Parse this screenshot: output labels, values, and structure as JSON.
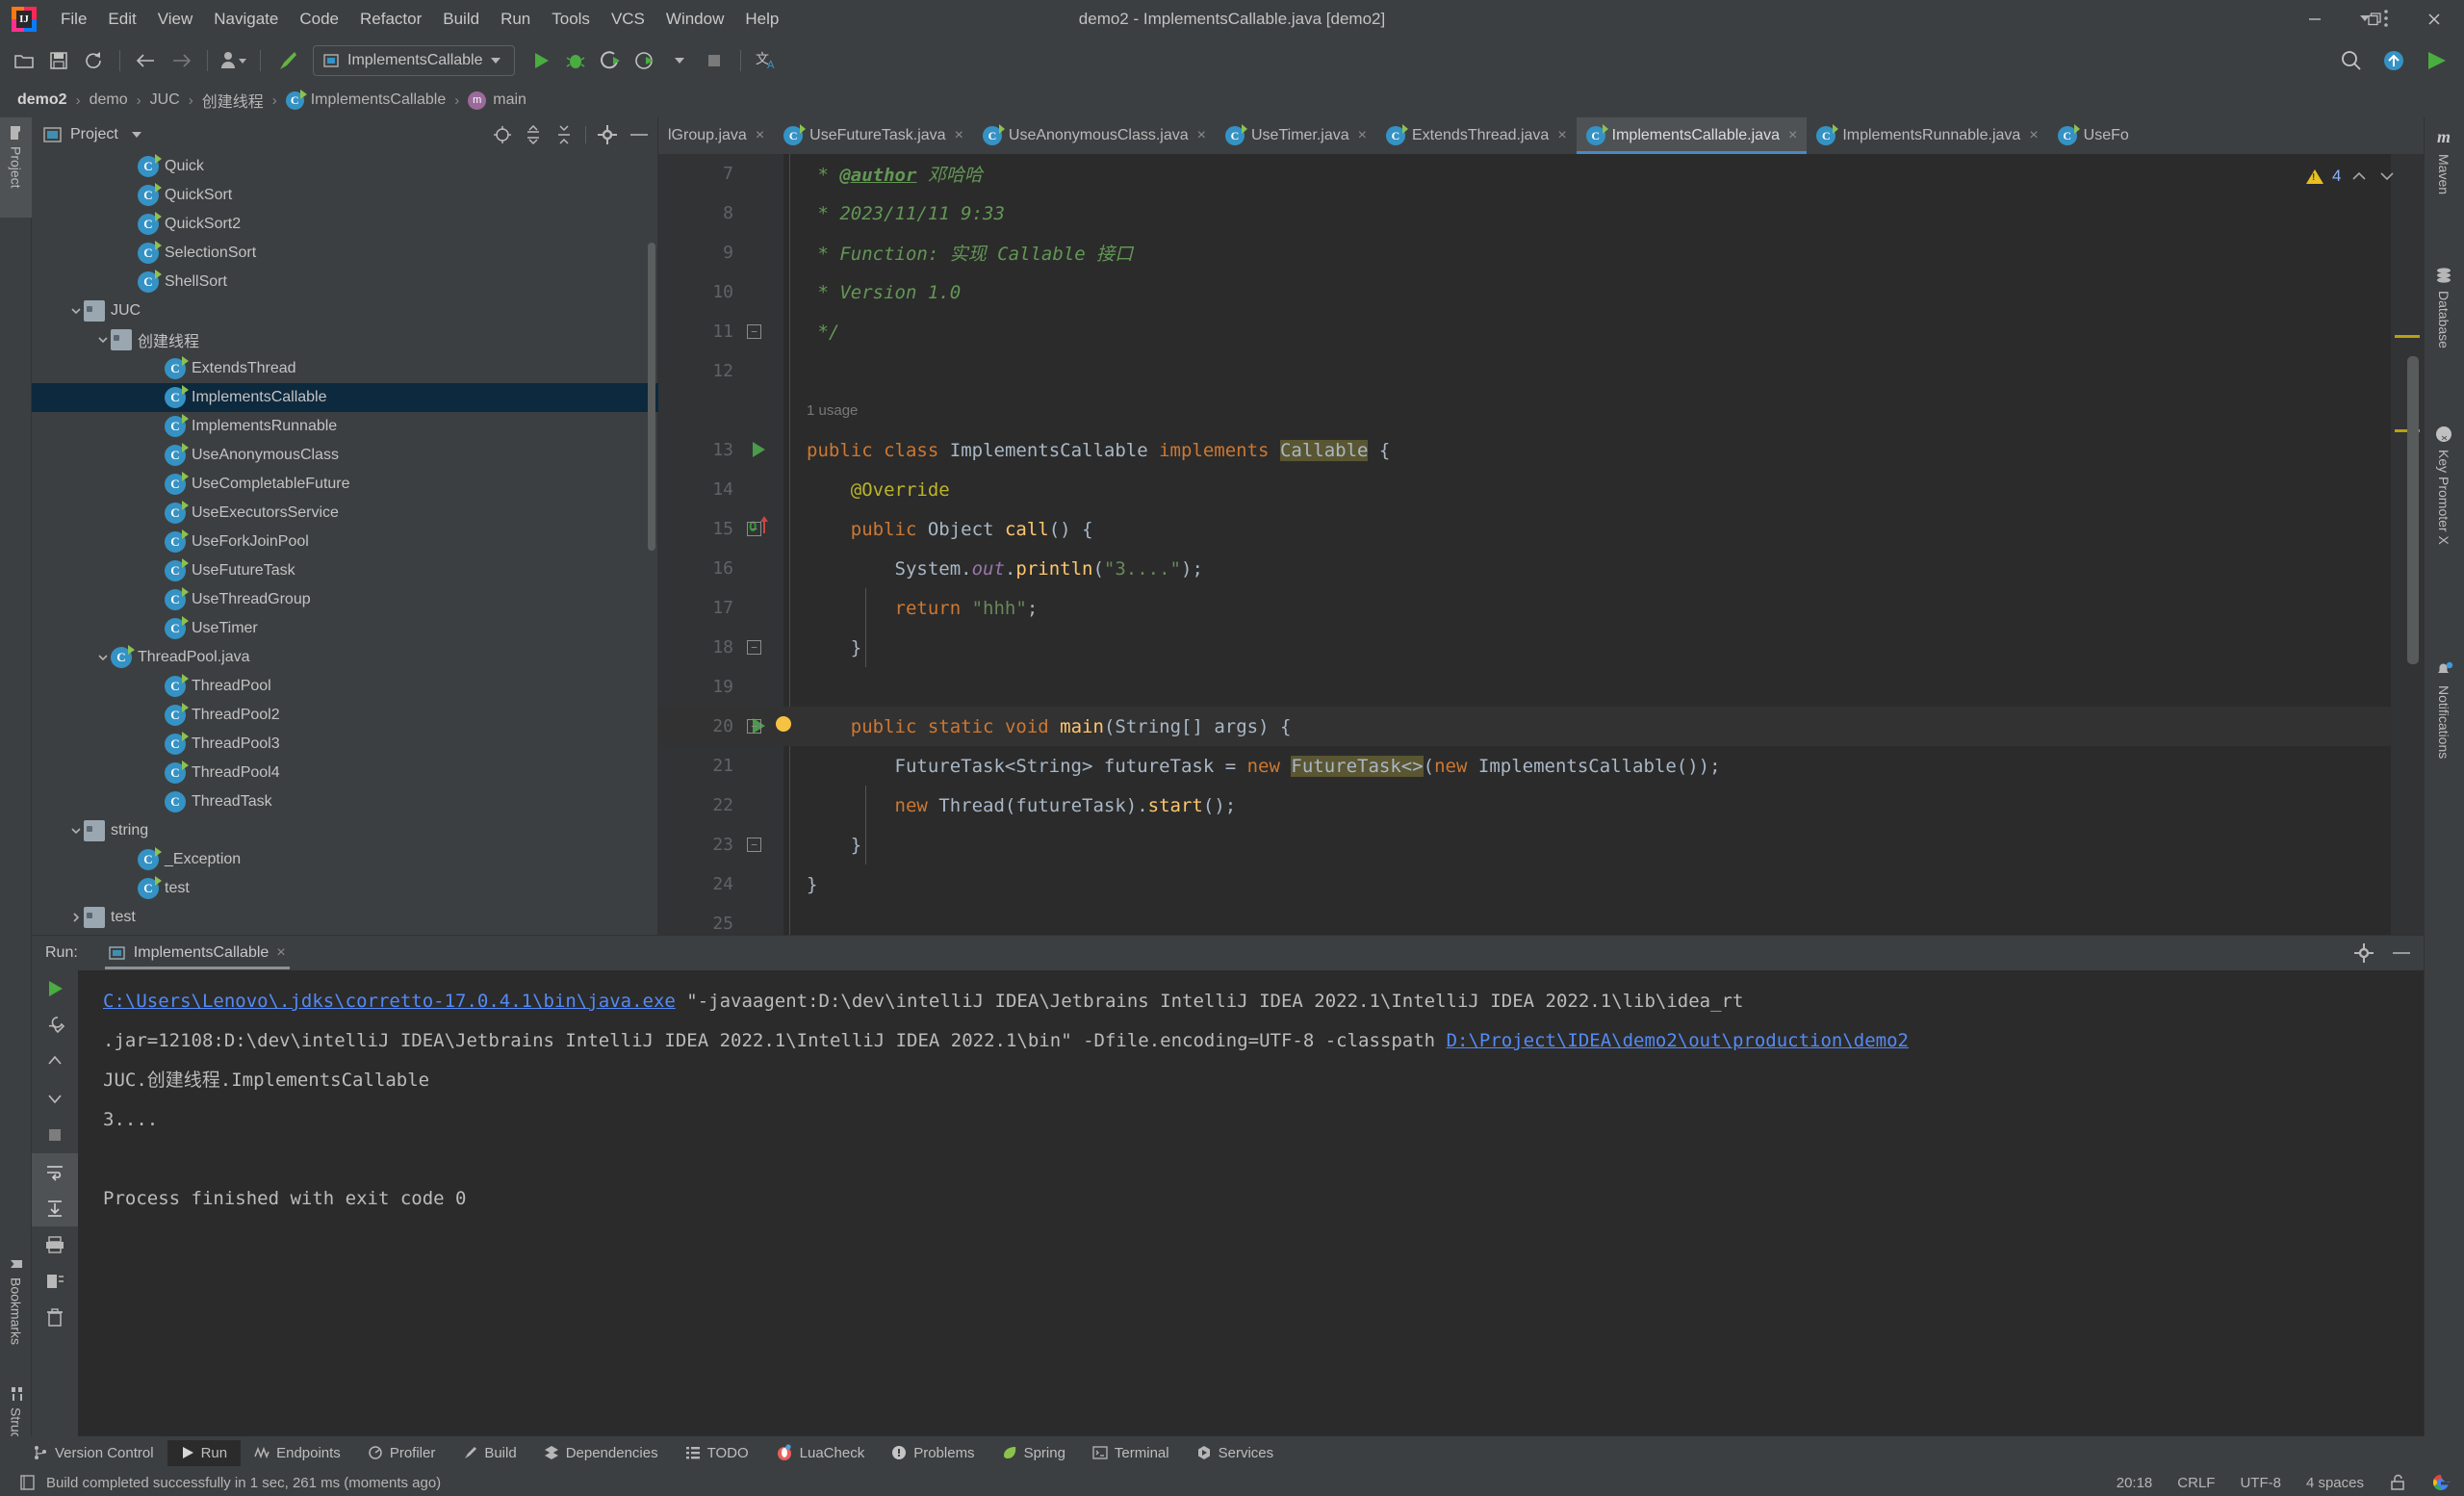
{
  "window": {
    "title": "demo2 - ImplementsCallable.java [demo2]",
    "minimize_label": "minimize-window",
    "restore_label": "restore-window",
    "close_label": "close-window"
  },
  "menubar": {
    "items": [
      "File",
      "Edit",
      "View",
      "Navigate",
      "Code",
      "Refactor",
      "Build",
      "Run",
      "Tools",
      "VCS",
      "Window",
      "Help"
    ]
  },
  "toolbar": {
    "open_icon": "folder-open-icon",
    "save_icon": "save-icon",
    "sync_icon": "refresh-icon",
    "back_icon": "arrow-left-icon",
    "forward_icon": "arrow-right-icon",
    "profile_icon": "user-profile-icon",
    "build_icon": "hammer-icon",
    "run_config": "ImplementsCallable",
    "run_icon": "run-icon",
    "debug_icon": "debug-icon",
    "coverage_icon": "run-with-coverage-icon",
    "profile_run_icon": "profile-icon",
    "stop_icon": "stop-icon",
    "translate_icon": "translate-icon",
    "search_icon": "search-everywhere-icon",
    "update_icon": "update-icon",
    "run_green_icon": "run-green-icon"
  },
  "breadcrumb": {
    "items": [
      "demo2",
      "demo",
      "JUC",
      "创建线程",
      "ImplementsCallable",
      "main"
    ],
    "separator": "›"
  },
  "left_strip": {
    "project": "Project",
    "bookmarks": "Bookmarks",
    "structure": "Structure"
  },
  "right_strip": {
    "maven": "Maven",
    "database": "Database",
    "key_promoter": "Key Promoter X",
    "notifications": "Notifications"
  },
  "project_panel": {
    "title": "Project",
    "tools": [
      "locate-icon",
      "expand-all-icon",
      "collapse-all-icon",
      "settings-gear-icon",
      "hide-icon"
    ],
    "tree": [
      {
        "label": "Quick",
        "depth": 4,
        "icon": "java-class-icon",
        "twisty": "",
        "selected": false
      },
      {
        "label": "QuickSort",
        "depth": 4,
        "icon": "java-class-icon",
        "twisty": "",
        "selected": false
      },
      {
        "label": "QuickSort2",
        "depth": 4,
        "icon": "java-class-icon",
        "twisty": "",
        "selected": false
      },
      {
        "label": "SelectionSort",
        "depth": 4,
        "icon": "java-class-icon",
        "twisty": "",
        "selected": false
      },
      {
        "label": "ShellSort",
        "depth": 4,
        "icon": "java-class-icon",
        "twisty": "",
        "selected": false
      },
      {
        "label": "JUC",
        "depth": 2,
        "icon": "folder-icon",
        "twisty": "expanded",
        "selected": false
      },
      {
        "label": "创建线程",
        "depth": 3,
        "icon": "folder-icon",
        "twisty": "expanded",
        "selected": false
      },
      {
        "label": "ExtendsThread",
        "depth": 5,
        "icon": "java-class-icon",
        "twisty": "",
        "selected": false
      },
      {
        "label": "ImplementsCallable",
        "depth": 5,
        "icon": "java-class-icon",
        "twisty": "",
        "selected": true
      },
      {
        "label": "ImplementsRunnable",
        "depth": 5,
        "icon": "java-class-icon",
        "twisty": "",
        "selected": false
      },
      {
        "label": "UseAnonymousClass",
        "depth": 5,
        "icon": "java-class-icon",
        "twisty": "",
        "selected": false
      },
      {
        "label": "UseCompletableFuture",
        "depth": 5,
        "icon": "java-class-icon",
        "twisty": "",
        "selected": false
      },
      {
        "label": "UseExecutorsService",
        "depth": 5,
        "icon": "java-class-icon",
        "twisty": "",
        "selected": false
      },
      {
        "label": "UseForkJoinPool",
        "depth": 5,
        "icon": "java-class-icon",
        "twisty": "",
        "selected": false
      },
      {
        "label": "UseFutureTask",
        "depth": 5,
        "icon": "java-class-icon",
        "twisty": "",
        "selected": false
      },
      {
        "label": "UseThreadGroup",
        "depth": 5,
        "icon": "java-class-icon",
        "twisty": "",
        "selected": false
      },
      {
        "label": "UseTimer",
        "depth": 5,
        "icon": "java-class-icon",
        "twisty": "",
        "selected": false
      },
      {
        "label": "ThreadPool.java",
        "depth": 3,
        "icon": "java-class-icon",
        "twisty": "expanded",
        "selected": false
      },
      {
        "label": "ThreadPool",
        "depth": 5,
        "icon": "java-class-icon",
        "twisty": "",
        "selected": false
      },
      {
        "label": "ThreadPool2",
        "depth": 5,
        "icon": "java-class-icon",
        "twisty": "",
        "selected": false
      },
      {
        "label": "ThreadPool3",
        "depth": 5,
        "icon": "java-class-icon",
        "twisty": "",
        "selected": false
      },
      {
        "label": "ThreadPool4",
        "depth": 5,
        "icon": "java-class-icon",
        "twisty": "",
        "selected": false
      },
      {
        "label": "ThreadTask",
        "depth": 5,
        "icon": "java-class-plain-icon",
        "twisty": "",
        "selected": false
      },
      {
        "label": "string",
        "depth": 2,
        "icon": "folder-icon",
        "twisty": "expanded",
        "selected": false
      },
      {
        "label": "_Exception",
        "depth": 4,
        "icon": "java-class-icon",
        "twisty": "",
        "selected": false
      },
      {
        "label": "test",
        "depth": 4,
        "icon": "java-class-icon",
        "twisty": "",
        "selected": false
      },
      {
        "label": "test",
        "depth": 2,
        "icon": "folder-icon",
        "twisty": "collapsed",
        "selected": false
      }
    ]
  },
  "editor_tabs": {
    "items": [
      {
        "label": "lGroup.java",
        "active": false,
        "icon": "java-class-icon",
        "truncated": true
      },
      {
        "label": "UseFutureTask.java",
        "active": false,
        "icon": "java-class-icon"
      },
      {
        "label": "UseAnonymousClass.java",
        "active": false,
        "icon": "java-class-icon"
      },
      {
        "label": "UseTimer.java",
        "active": false,
        "icon": "java-class-icon"
      },
      {
        "label": "ExtendsThread.java",
        "active": false,
        "icon": "java-class-icon"
      },
      {
        "label": "ImplementsCallable.java",
        "active": true,
        "icon": "java-class-icon"
      },
      {
        "label": "ImplementsRunnable.java",
        "active": false,
        "icon": "java-class-icon"
      },
      {
        "label": "UseFo",
        "active": false,
        "icon": "java-class-icon",
        "truncated": true
      }
    ],
    "close_glyph": "×",
    "overflow_icon": "chevron-down-icon",
    "more_icon": "more-options-icon"
  },
  "editor": {
    "usage_hint": "1 usage",
    "inspection_count": "4",
    "inspection_icon": "warning-triangle-icon",
    "prev_icon": "chevron-up-icon",
    "next_icon": "chevron-down-icon",
    "lines": [
      {
        "no": "7",
        "text": " * @author 邓哈哈"
      },
      {
        "no": "8",
        "text": " * 2023/11/11 9:33"
      },
      {
        "no": "9",
        "text": " * Function: 实现 Callable 接口"
      },
      {
        "no": "10",
        "text": " * Version 1.0"
      },
      {
        "no": "11",
        "text": " */"
      },
      {
        "no": "12",
        "text": ""
      },
      {
        "no": "",
        "text": "1 usage"
      },
      {
        "no": "13",
        "text": "public class ImplementsCallable implements Callable {"
      },
      {
        "no": "14",
        "text": "    @Override"
      },
      {
        "no": "15",
        "text": "    public Object call() {"
      },
      {
        "no": "16",
        "text": "        System.out.println(\"3....\");"
      },
      {
        "no": "17",
        "text": "        return \"hhh\";"
      },
      {
        "no": "18",
        "text": "    }"
      },
      {
        "no": "19",
        "text": ""
      },
      {
        "no": "20",
        "text": "    public static void main(String[] args) {"
      },
      {
        "no": "21",
        "text": "        FutureTask<String> futureTask = new FutureTask<>(new ImplementsCallable());"
      },
      {
        "no": "22",
        "text": "        new Thread(futureTask).start();"
      },
      {
        "no": "23",
        "text": "    }"
      },
      {
        "no": "24",
        "text": "}"
      },
      {
        "no": "25",
        "text": ""
      }
    ]
  },
  "run_panel": {
    "label": "Run:",
    "tab": "ImplementsCallable",
    "tab_icon": "run-configuration-icon",
    "close_glyph": "×",
    "settings_icon": "settings-gear-icon",
    "hide_icon": "hide-icon",
    "side_buttons": [
      "rerun-icon",
      "wrench-icon",
      "scroll-up-icon",
      "scroll-down-icon",
      "stop-icon",
      "soft-wrap-icon",
      "scroll-to-end-icon",
      "print-icon",
      "clear-all-icon",
      "trash-icon"
    ],
    "console": [
      {
        "parts": [
          {
            "t": "C:\\Users\\Lenovo\\.jdks\\corretto-17.0.4.1\\bin\\java.exe",
            "link": true
          },
          {
            "t": " \"-javaagent:D:\\dev\\intelliJ IDEA\\Jetbrains IntelliJ IDEA 2022.1\\IntelliJ IDEA 2022.1\\lib\\idea_rt",
            "link": false
          }
        ]
      },
      {
        "parts": [
          {
            "t": ".jar=12108:D:\\dev\\intelliJ IDEA\\Jetbrains IntelliJ IDEA 2022.1\\IntelliJ IDEA 2022.1\\bin\" -Dfile.encoding=UTF-8 -classpath ",
            "link": false
          },
          {
            "t": "D:\\Project\\IDEA\\demo2\\out\\production\\demo2",
            "link": true
          }
        ]
      },
      {
        "parts": [
          {
            "t": "JUC.创建线程.ImplementsCallable",
            "link": false
          }
        ]
      },
      {
        "parts": [
          {
            "t": "3....",
            "link": false
          }
        ]
      },
      {
        "parts": [
          {
            "t": "",
            "link": false
          }
        ]
      },
      {
        "parts": [
          {
            "t": "Process finished with exit code 0",
            "link": false
          }
        ]
      }
    ]
  },
  "bottom_bar": {
    "items": [
      {
        "label": "Version Control",
        "icon": "branch-icon",
        "active": false
      },
      {
        "label": "Run",
        "icon": "run-icon",
        "active": true
      },
      {
        "label": "Endpoints",
        "icon": "endpoints-icon",
        "active": false
      },
      {
        "label": "Profiler",
        "icon": "profiler-icon",
        "active": false
      },
      {
        "label": "Build",
        "icon": "hammer-icon",
        "active": false
      },
      {
        "label": "Dependencies",
        "icon": "dependencies-icon",
        "active": false
      },
      {
        "label": "TODO",
        "icon": "todo-icon",
        "active": false
      },
      {
        "label": "LuaCheck",
        "icon": "luacheck-icon",
        "active": false
      },
      {
        "label": "Problems",
        "icon": "problems-icon",
        "active": false
      },
      {
        "label": "Spring",
        "icon": "spring-leaf-icon",
        "active": false
      },
      {
        "label": "Terminal",
        "icon": "terminal-icon",
        "active": false
      },
      {
        "label": "Services",
        "icon": "services-icon",
        "active": false
      }
    ]
  },
  "status_bar": {
    "message": "Build completed successfully in 1 sec, 261 ms (moments ago)",
    "message_icon": "build-status-icon",
    "caret": "20:18",
    "line_separator": "CRLF",
    "encoding": "UTF-8",
    "indent": "4 spaces",
    "lock_icon": "unlocked-icon",
    "account_icon": "google-account-icon"
  },
  "colors": {
    "accent": "#4a88c7",
    "selection": "#0d293e",
    "editor_bg": "#2b2b2b",
    "panel_bg": "#3c3f41",
    "link": "#548af7",
    "warning": "#e8c020"
  }
}
